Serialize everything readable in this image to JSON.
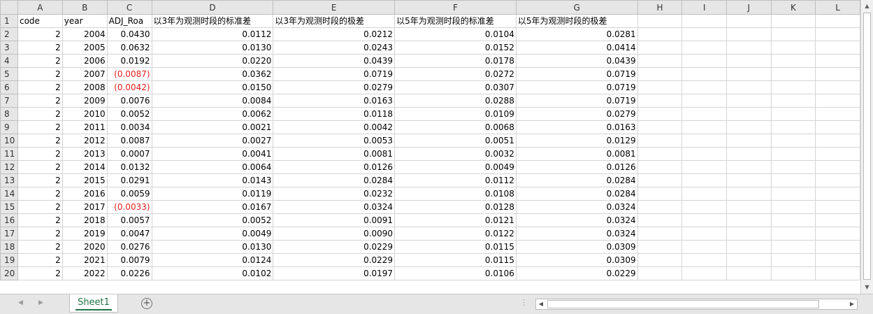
{
  "columns": [
    "A",
    "B",
    "C",
    "D",
    "E",
    "F",
    "G",
    "H",
    "I",
    "J",
    "K",
    "L"
  ],
  "header_row": {
    "row_num": "1",
    "cells": [
      "code",
      "year",
      "ADJ_Roa",
      "以3年为观测时段的标准差",
      "以3年为观测时段的极差",
      "以5年为观测时段的标准差",
      "以5年为观测时段的极差"
    ]
  },
  "rows": [
    {
      "n": "2",
      "code": "2",
      "year": "2004",
      "roa": "0.0430",
      "neg": false,
      "d": "0.0112",
      "e": "0.0212",
      "f": "0.0104",
      "g": "0.0281"
    },
    {
      "n": "3",
      "code": "2",
      "year": "2005",
      "roa": "0.0632",
      "neg": false,
      "d": "0.0130",
      "e": "0.0243",
      "f": "0.0152",
      "g": "0.0414"
    },
    {
      "n": "4",
      "code": "2",
      "year": "2006",
      "roa": "0.0192",
      "neg": false,
      "d": "0.0220",
      "e": "0.0439",
      "f": "0.0178",
      "g": "0.0439"
    },
    {
      "n": "5",
      "code": "2",
      "year": "2007",
      "roa": "(0.0087)",
      "neg": true,
      "d": "0.0362",
      "e": "0.0719",
      "f": "0.0272",
      "g": "0.0719"
    },
    {
      "n": "6",
      "code": "2",
      "year": "2008",
      "roa": "(0.0042)",
      "neg": true,
      "d": "0.0150",
      "e": "0.0279",
      "f": "0.0307",
      "g": "0.0719"
    },
    {
      "n": "7",
      "code": "2",
      "year": "2009",
      "roa": "0.0076",
      "neg": false,
      "d": "0.0084",
      "e": "0.0163",
      "f": "0.0288",
      "g": "0.0719"
    },
    {
      "n": "8",
      "code": "2",
      "year": "2010",
      "roa": "0.0052",
      "neg": false,
      "d": "0.0062",
      "e": "0.0118",
      "f": "0.0109",
      "g": "0.0279"
    },
    {
      "n": "9",
      "code": "2",
      "year": "2011",
      "roa": "0.0034",
      "neg": false,
      "d": "0.0021",
      "e": "0.0042",
      "f": "0.0068",
      "g": "0.0163"
    },
    {
      "n": "10",
      "code": "2",
      "year": "2012",
      "roa": "0.0087",
      "neg": false,
      "d": "0.0027",
      "e": "0.0053",
      "f": "0.0051",
      "g": "0.0129"
    },
    {
      "n": "11",
      "code": "2",
      "year": "2013",
      "roa": "0.0007",
      "neg": false,
      "d": "0.0041",
      "e": "0.0081",
      "f": "0.0032",
      "g": "0.0081"
    },
    {
      "n": "12",
      "code": "2",
      "year": "2014",
      "roa": "0.0132",
      "neg": false,
      "d": "0.0064",
      "e": "0.0126",
      "f": "0.0049",
      "g": "0.0126"
    },
    {
      "n": "13",
      "code": "2",
      "year": "2015",
      "roa": "0.0291",
      "neg": false,
      "d": "0.0143",
      "e": "0.0284",
      "f": "0.0112",
      "g": "0.0284"
    },
    {
      "n": "14",
      "code": "2",
      "year": "2016",
      "roa": "0.0059",
      "neg": false,
      "d": "0.0119",
      "e": "0.0232",
      "f": "0.0108",
      "g": "0.0284"
    },
    {
      "n": "15",
      "code": "2",
      "year": "2017",
      "roa": "(0.0033)",
      "neg": true,
      "d": "0.0167",
      "e": "0.0324",
      "f": "0.0128",
      "g": "0.0324"
    },
    {
      "n": "16",
      "code": "2",
      "year": "2018",
      "roa": "0.0057",
      "neg": false,
      "d": "0.0052",
      "e": "0.0091",
      "f": "0.0121",
      "g": "0.0324"
    },
    {
      "n": "17",
      "code": "2",
      "year": "2019",
      "roa": "0.0047",
      "neg": false,
      "d": "0.0049",
      "e": "0.0090",
      "f": "0.0122",
      "g": "0.0324"
    },
    {
      "n": "18",
      "code": "2",
      "year": "2020",
      "roa": "0.0276",
      "neg": false,
      "d": "0.0130",
      "e": "0.0229",
      "f": "0.0115",
      "g": "0.0309"
    },
    {
      "n": "19",
      "code": "2",
      "year": "2021",
      "roa": "0.0079",
      "neg": false,
      "d": "0.0124",
      "e": "0.0229",
      "f": "0.0115",
      "g": "0.0309"
    },
    {
      "n": "20",
      "code": "2",
      "year": "2022",
      "roa": "0.0226",
      "neg": false,
      "d": "0.0102",
      "e": "0.0197",
      "f": "0.0106",
      "g": "0.0229"
    }
  ],
  "sheet_tab": "Sheet1",
  "add_sheet_symbol": "+",
  "colors": {
    "negative": "#e02020",
    "tab_accent": "#217346",
    "header_bg": "#e6e6e6"
  },
  "icons": {
    "nav_prev": "chevron-left-icon",
    "nav_next": "chevron-right-icon",
    "add_sheet": "plus-circle-icon",
    "scroll_up": "triangle-up-icon",
    "scroll_down": "triangle-down-icon"
  }
}
